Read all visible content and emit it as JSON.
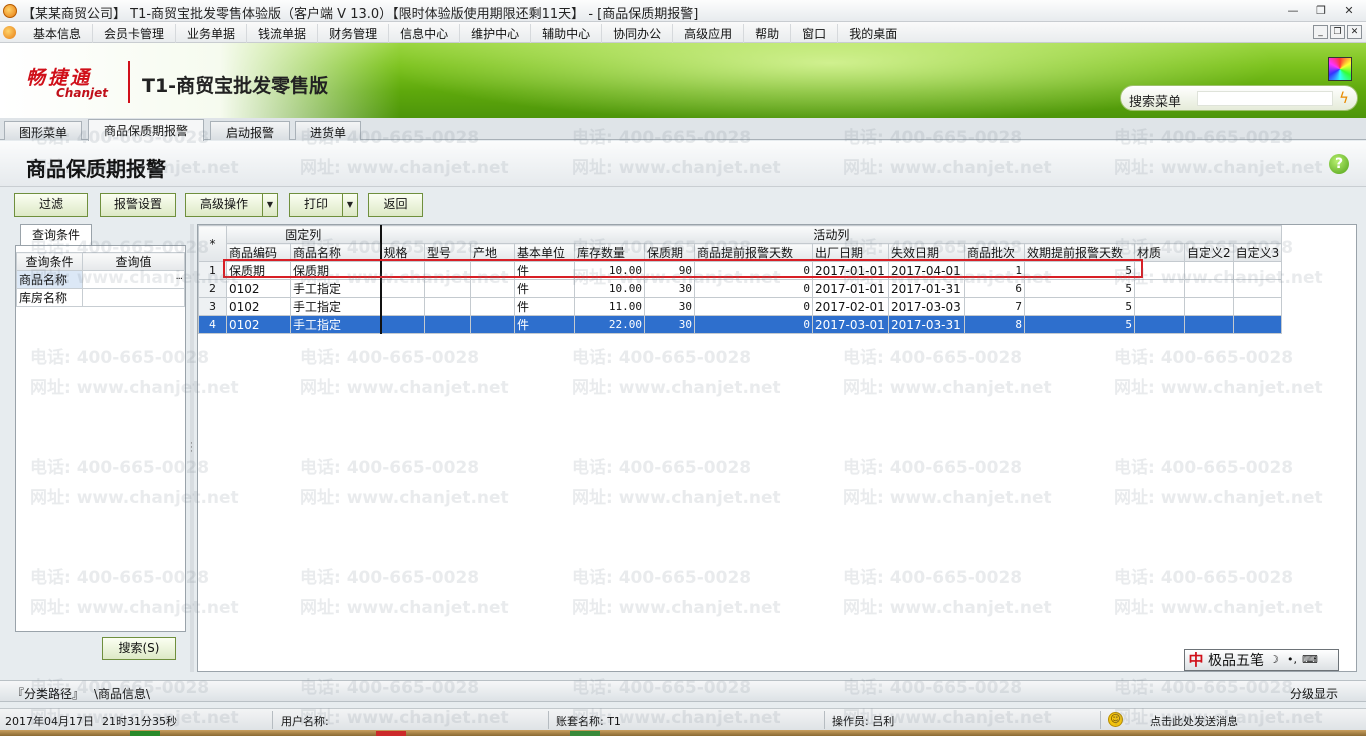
{
  "window": {
    "title": "【某某商贸公司】 T1-商贸宝批发零售体验版（客户端 V 13.0）【限时体验版使用期限还剩11天】 - [商品保质期报警]",
    "controls": [
      "—",
      "❐",
      "✕"
    ]
  },
  "menu": {
    "items": [
      "基本信息",
      "会员卡管理",
      "业务单据",
      "钱流单据",
      "财务管理",
      "信息中心",
      "维护中心",
      "辅助中心",
      "协同办公",
      "高级应用",
      "帮助",
      "窗口",
      "我的桌面"
    ],
    "mdi_controls": [
      "_",
      "❐",
      "✕"
    ]
  },
  "banner": {
    "logo_cn": "畅捷通",
    "logo_en": "Chanjet",
    "product": "T1-商贸宝批发零售版",
    "search_label": "搜索菜单",
    "search_value": ""
  },
  "doc_tabs": [
    "图形菜单",
    "商品保质期报警",
    "启动报警",
    "进货单"
  ],
  "page": {
    "title": "商品保质期报警",
    "help": "?"
  },
  "toolbar": {
    "filter": "过滤",
    "alarm_settings": "报警设置",
    "advanced": "高级操作",
    "print": "打印",
    "back": "返回",
    "dropdown": "▼"
  },
  "left_panel": {
    "tab": "查询条件",
    "col_condition": "查询条件",
    "col_value": "查询值",
    "rows": [
      {
        "condition": "商品名称",
        "value": ""
      },
      {
        "condition": "库房名称",
        "value": ""
      }
    ],
    "ellipsis": "···",
    "search_button": "搜索(S)"
  },
  "grid": {
    "group_fixed": "固定列",
    "group_active": "活动列",
    "corner": "*",
    "columns": [
      "商品编码",
      "商品名称",
      "规格",
      "型号",
      "产地",
      "基本单位",
      "库存数量",
      "保质期",
      "商品提前报警天数",
      "出厂日期",
      "失效日期",
      "商品批次",
      "效期提前报警天数",
      "材质",
      "自定义2",
      "自定义3"
    ],
    "rows": [
      {
        "n": "1",
        "code": "保质期",
        "name": "保质期",
        "spec": "",
        "model": "",
        "origin": "",
        "unit": "件",
        "qty": "10.00",
        "shelf": "90",
        "warn_days": "0",
        "mfg": "2017-01-01",
        "exp": "2017-04-01",
        "batch": "1",
        "exp_warn": "5",
        "material": "",
        "c2": "",
        "c3": ""
      },
      {
        "n": "2",
        "code": "0102",
        "name": "手工指定",
        "spec": "",
        "model": "",
        "origin": "",
        "unit": "件",
        "qty": "10.00",
        "shelf": "30",
        "warn_days": "0",
        "mfg": "2017-01-01",
        "exp": "2017-01-31",
        "batch": "6",
        "exp_warn": "5",
        "material": "",
        "c2": "",
        "c3": ""
      },
      {
        "n": "3",
        "code": "0102",
        "name": "手工指定",
        "spec": "",
        "model": "",
        "origin": "",
        "unit": "件",
        "qty": "11.00",
        "shelf": "30",
        "warn_days": "0",
        "mfg": "2017-02-01",
        "exp": "2017-03-03",
        "batch": "7",
        "exp_warn": "5",
        "material": "",
        "c2": "",
        "c3": ""
      },
      {
        "n": "4",
        "code": "0102",
        "name": "手工指定",
        "spec": "",
        "model": "",
        "origin": "",
        "unit": "件",
        "qty": "22.00",
        "shelf": "30",
        "warn_days": "0",
        "mfg": "2017-03-01",
        "exp": "2017-03-31",
        "batch": "8",
        "exp_warn": "5",
        "material": "",
        "c2": "",
        "c3": ""
      }
    ],
    "selected_row": 4
  },
  "ime": {
    "icon": "中",
    "label": "极品五笔",
    "moon": "☽",
    "punct": "•,",
    "keyboard": "⌨"
  },
  "bottom_nav": {
    "path_label": "『分类路径』",
    "path_value": "\\商品信息\\",
    "group_display": "分级显示"
  },
  "status": {
    "date": "2017年04月17日",
    "time": "21时31分35秒",
    "user_label": "用户名称:",
    "account": "账套名称: T1",
    "operator": "操作员: 吕利",
    "smile": "☺",
    "message": "点击此处发送消息"
  },
  "watermark": {
    "phone": "电话: 400-665-0028",
    "site": "网址: www.chanjet.net"
  },
  "colors": {
    "banner_green": "#6cb517",
    "selected_row": "#2e6fcd",
    "highlight_red": "#d81f26"
  }
}
